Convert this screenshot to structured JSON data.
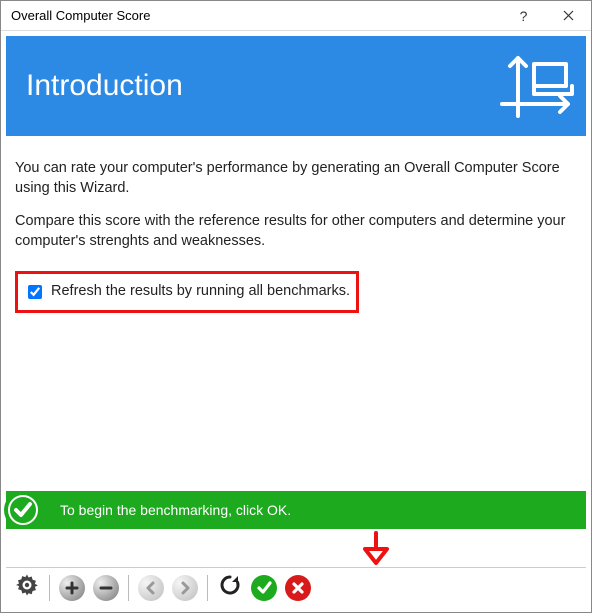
{
  "window": {
    "title": "Overall Computer Score"
  },
  "header": {
    "title": "Introduction"
  },
  "body": {
    "p1": "You can rate your computer's performance by generating an Overall Computer Score using this Wizard.",
    "p2": "Compare this score with the reference results for other computers and determine your computer's strenghts and weaknesses.",
    "checkbox_label": "Refresh the results by running all benchmarks.",
    "checkbox_checked": true
  },
  "status": {
    "message": "To begin the benchmarking, click OK."
  },
  "colors": {
    "accent_blue": "#2c89e4",
    "ok_green": "#1eaa1e",
    "cancel_red": "#d91a1a",
    "highlight_red": "#e11"
  },
  "toolbar": {
    "icons": [
      "gear",
      "zoom-in",
      "zoom-out",
      "back",
      "forward",
      "refresh",
      "ok",
      "cancel"
    ]
  }
}
